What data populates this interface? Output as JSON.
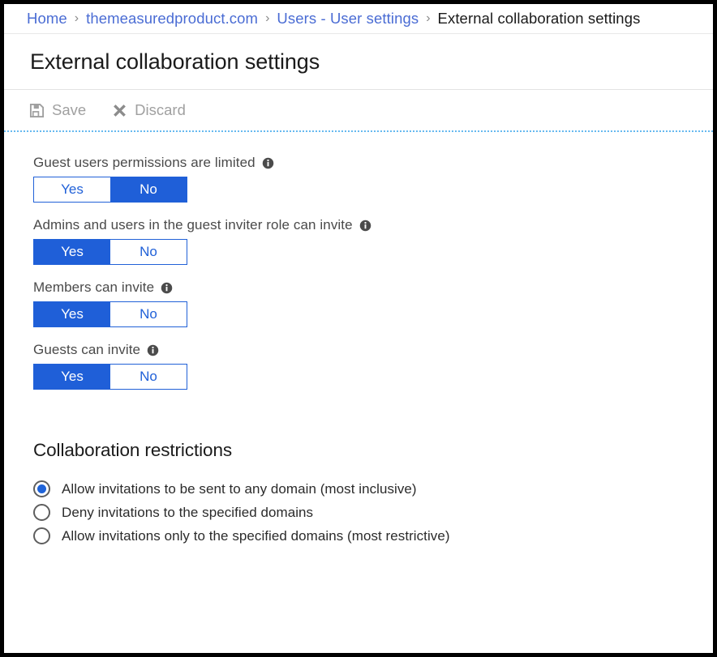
{
  "breadcrumb": {
    "separator": "›",
    "items": [
      {
        "label": "Home",
        "current": false
      },
      {
        "label": "themeasuredproduct.com",
        "current": false
      },
      {
        "label": "Users - User settings",
        "current": false
      },
      {
        "label": "External collaboration settings",
        "current": true
      }
    ]
  },
  "header": {
    "title": "External collaboration settings"
  },
  "toolbar": {
    "save_label": "Save",
    "save_icon": "save-floppy-icon",
    "discard_label": "Discard",
    "discard_icon": "close-x-icon",
    "disabled_color": "#a0a0a0"
  },
  "settings": [
    {
      "label": "Guest users permissions are limited",
      "info_icon": "info-icon",
      "yes_label": "Yes",
      "no_label": "No",
      "value": "No"
    },
    {
      "label": "Admins and users in the guest inviter role can invite",
      "info_icon": "info-icon",
      "yes_label": "Yes",
      "no_label": "No",
      "value": "Yes"
    },
    {
      "label": "Members can invite",
      "info_icon": "info-icon",
      "yes_label": "Yes",
      "no_label": "No",
      "value": "Yes"
    },
    {
      "label": "Guests can invite",
      "info_icon": "info-icon",
      "yes_label": "Yes",
      "no_label": "No",
      "value": "Yes"
    }
  ],
  "collaboration_restrictions": {
    "title": "Collaboration restrictions",
    "options": [
      {
        "label": "Allow invitations to be sent to any domain (most inclusive)",
        "checked": true
      },
      {
        "label": "Deny invitations to the specified domains",
        "checked": false
      },
      {
        "label": "Allow invitations only to the specified domains (most restrictive)",
        "checked": false
      }
    ]
  },
  "colors": {
    "accent_blue": "#1f5fd8",
    "link_blue": "#4a6cd4",
    "toggle_border": "#2161d8",
    "divider_blue": "#66b9f0",
    "disabled_gray": "#a0a0a0",
    "text_dark": "#1b1b1b",
    "label_gray": "#4a4a4a"
  }
}
